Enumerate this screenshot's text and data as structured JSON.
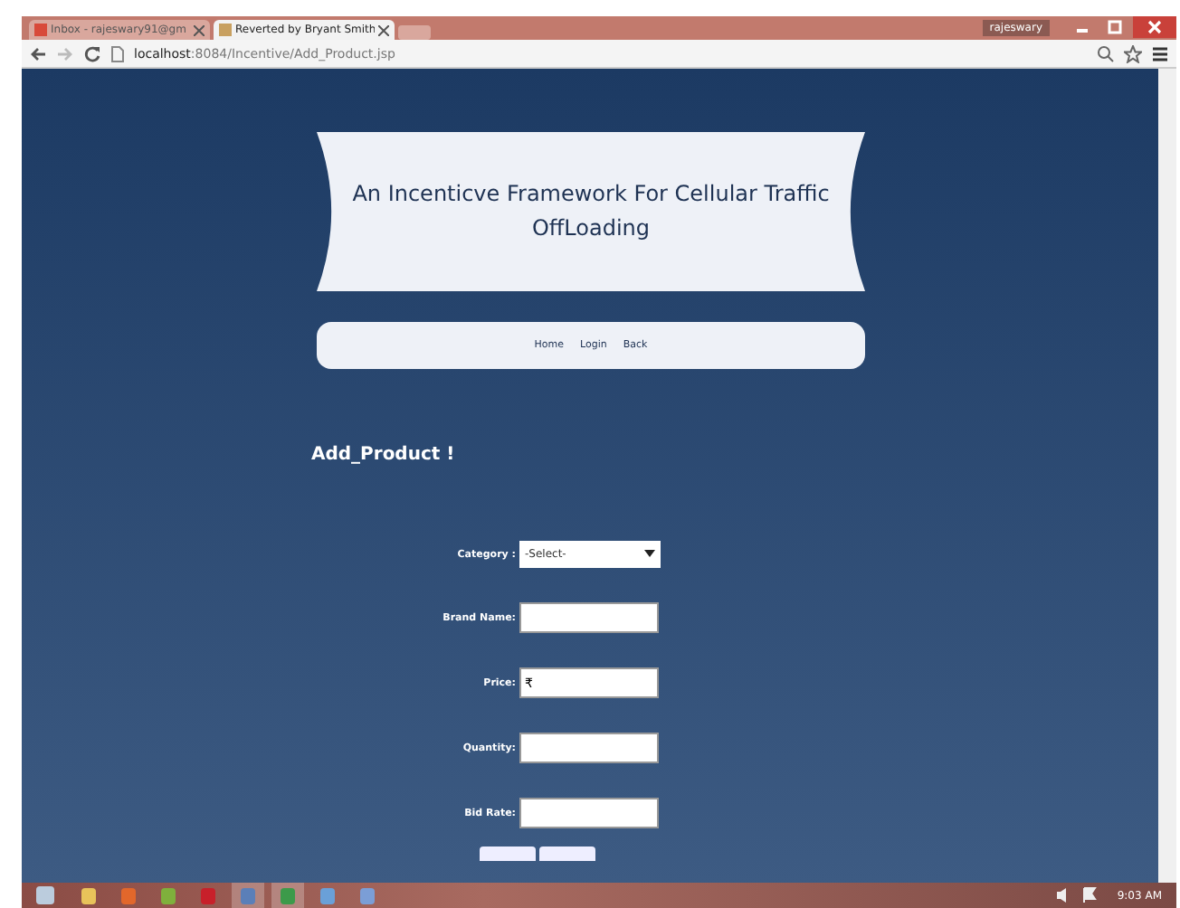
{
  "browser": {
    "tabs": [
      {
        "label": "Inbox - rajeswary91@gm",
        "selected": false
      },
      {
        "label": "Reverted by Bryant Smith",
        "selected": true
      }
    ],
    "user": "rajeswary",
    "url_host": "localhost",
    "url_path": ":8084/Incentive/Add_Product.jsp"
  },
  "page": {
    "title": "An Incenticve Framework For Cellular Traffic OffLoading",
    "nav": [
      "Home",
      "Login",
      "Back"
    ],
    "heading": "Add_Product !",
    "category": {
      "label": "Category :",
      "value": "-Select-"
    },
    "fields": [
      {
        "label": "Brand Name:"
      },
      {
        "label": "Price:",
        "value": "₹"
      },
      {
        "label": "Quantity:"
      },
      {
        "label": "Bid Rate:"
      }
    ]
  },
  "taskbar": {
    "clock": "9:03 AM"
  }
}
